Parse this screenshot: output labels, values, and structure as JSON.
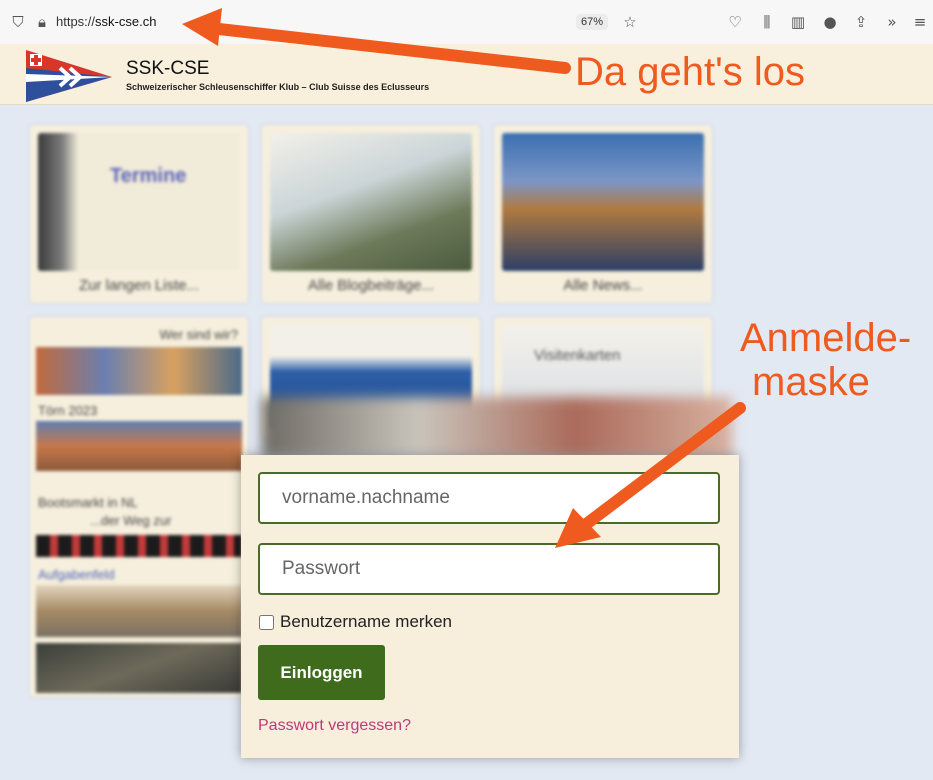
{
  "browser": {
    "url_prefix": "https://",
    "url_host": "ssk-cse.ch",
    "zoom": "67%"
  },
  "site": {
    "name": "SSK-CSE",
    "subtitle": "Schweizerischer Schleusenschiffer Klub – Club Suisse des Eclusseurs"
  },
  "tiles": [
    {
      "title": "Termine",
      "caption": "Zur langen Liste..."
    },
    {
      "title": "",
      "caption": "Alle Blogbeiträge..."
    },
    {
      "title": "",
      "caption": "Alle News..."
    },
    {
      "title": "Wer sind wir?",
      "caption": ""
    },
    {
      "title": "",
      "caption": ""
    },
    {
      "title": "Visitenkarten",
      "caption": ""
    }
  ],
  "sidebar_labels": [
    "Törn 2023",
    "Bootsmarkt in NL",
    "...der Weg zur",
    "Aufgabenfeld"
  ],
  "login": {
    "username_placeholder": "vorname.nachname",
    "password_placeholder": "Passwort",
    "remember_label": "Benutzername merken",
    "submit_label": "Einloggen",
    "forgot_label": "Passwort vergessen?"
  },
  "annotations": {
    "top": "Da geht's los",
    "right_line1": "Anmelde-",
    "right_line2": "maske"
  },
  "colors": {
    "accent_green": "#3f6b1c",
    "link_pink": "#c2367a",
    "annotation_orange": "#ef5a1e"
  }
}
